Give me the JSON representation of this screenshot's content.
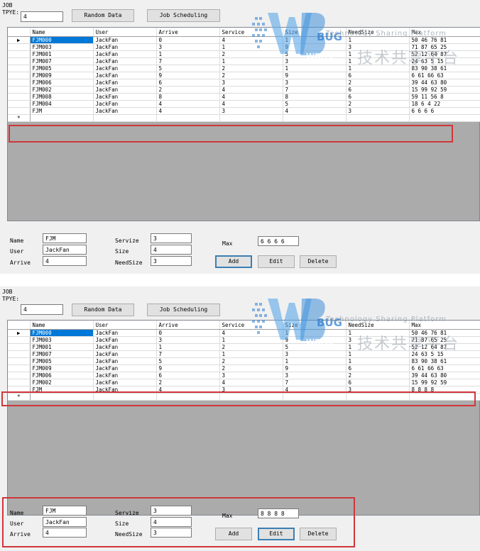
{
  "columns": [
    "Name",
    "User",
    "Arrive",
    "Service",
    "Size",
    "NeedSize",
    "Max"
  ],
  "screens": [
    {
      "job_label": "JOB",
      "type_label": "TPYE:",
      "type_value": "4",
      "random_button": "Random Data",
      "schedule_button": "Job Scheduling",
      "rows": [
        [
          "FJM000",
          "JackFan",
          "0",
          "4",
          "1",
          "1",
          "50 46 76 81"
        ],
        [
          "FJM003",
          "JackFan",
          "3",
          "1",
          "9",
          "3",
          "71 87 65 25"
        ],
        [
          "FJM001",
          "JackFan",
          "1",
          "2",
          "5",
          "1",
          "52 12 64 87"
        ],
        [
          "FJM007",
          "JackFan",
          "7",
          "1",
          "3",
          "1",
          "24 63 5 15"
        ],
        [
          "FJM005",
          "JackFan",
          "5",
          "2",
          "1",
          "1",
          "83 90 38 61"
        ],
        [
          "FJM009",
          "JackFan",
          "9",
          "2",
          "9",
          "6",
          "6 61 66 63"
        ],
        [
          "FJM006",
          "JackFan",
          "6",
          "3",
          "3",
          "2",
          "39 44 63 80"
        ],
        [
          "FJM002",
          "JackFan",
          "2",
          "4",
          "7",
          "6",
          "15 99 92 59"
        ],
        [
          "FJM008",
          "JackFan",
          "8",
          "4",
          "8",
          "6",
          "59 11 56 8"
        ],
        [
          "FJM004",
          "JackFan",
          "4",
          "4",
          "5",
          "2",
          "18 6 4 22"
        ],
        [
          "FJM",
          "JackFan",
          "4",
          "3",
          "4",
          "3",
          "6 6 6 6"
        ]
      ],
      "form": {
        "name_label": "Name",
        "name_value": "FJM",
        "user_label": "User",
        "user_value": "JackFan",
        "arrive_label": "Arrive",
        "arrive_value": "4",
        "service_label": "Servize",
        "service_value": "3",
        "size_label": "Size",
        "size_value": "4",
        "needsize_label": "NeedSize",
        "needsize_value": "3",
        "max_label": "Max",
        "max_value": "6 6 6 6",
        "add_button": "Add",
        "edit_button": "Edit",
        "delete_button": "Delete"
      }
    },
    {
      "job_label": "JOB",
      "type_label": "TPYE:",
      "type_value": "4",
      "random_button": "Random Data",
      "schedule_button": "Job Scheduling",
      "rows": [
        [
          "FJM000",
          "JackFan",
          "0",
          "4",
          "1",
          "1",
          "50 46 76 81"
        ],
        [
          "FJM003",
          "JackFan",
          "3",
          "1",
          "9",
          "3",
          "71 87 65 25"
        ],
        [
          "FJM001",
          "JackFan",
          "1",
          "2",
          "5",
          "1",
          "52 12 64 87"
        ],
        [
          "FJM007",
          "JackFan",
          "7",
          "1",
          "3",
          "1",
          "24 63 5 15"
        ],
        [
          "FJM005",
          "JackFan",
          "5",
          "2",
          "1",
          "1",
          "83 90 38 61"
        ],
        [
          "FJM009",
          "JackFan",
          "9",
          "2",
          "9",
          "6",
          "6 61 66 63"
        ],
        [
          "FJM006",
          "JackFan",
          "6",
          "3",
          "3",
          "2",
          "39 44 63 80"
        ],
        [
          "FJM002",
          "JackFan",
          "2",
          "4",
          "7",
          "6",
          "15 99 92 59"
        ],
        [
          "FJM",
          "JackFan",
          "4",
          "3",
          "4",
          "3",
          "8 8 8 8"
        ]
      ],
      "form": {
        "name_label": "Name",
        "name_value": "FJM",
        "user_label": "User",
        "user_value": "JackFan",
        "arrive_label": "Arrive",
        "arrive_value": "4",
        "service_label": "Servize",
        "service_value": "3",
        "size_label": "Size",
        "size_value": "4",
        "needsize_label": "NeedSize",
        "needsize_value": "3",
        "max_label": "Max",
        "max_value": "8 8 8 8",
        "add_button": "Add",
        "edit_button": "Edit",
        "delete_button": "Delete"
      }
    }
  ],
  "watermark": {
    "logo_letters": "WB",
    "bug_text": "BUG",
    "write_text": "WRITE",
    "tagline": "Technology Sharing Platform",
    "cn_text": "技术共享平台"
  },
  "colors": {
    "selection": "#0078d7",
    "highlight_box": "#d0363b",
    "focus_border": "#3c7fb1",
    "grid_background": "#ababab"
  }
}
